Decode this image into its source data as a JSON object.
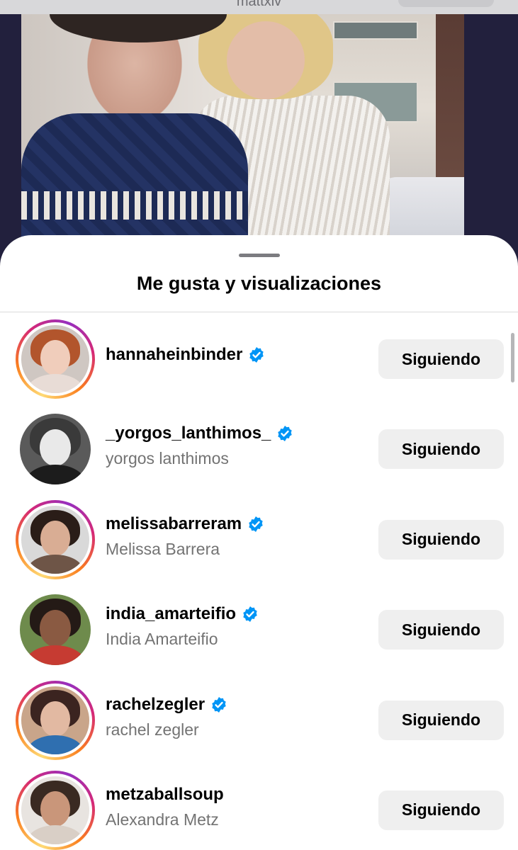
{
  "background": {
    "owner_username": "mattxiv"
  },
  "sheet": {
    "title": "Me gusta y visualizaciones"
  },
  "users": [
    {
      "username": "hannaheinbinder",
      "fullname": "",
      "verified": true,
      "story_ring": true,
      "button": "Siguiendo"
    },
    {
      "username": "_yorgos_lanthimos_",
      "fullname": "yorgos lanthimos",
      "verified": true,
      "story_ring": false,
      "button": "Siguiendo"
    },
    {
      "username": "melissabarreram",
      "fullname": "Melissa Barrera",
      "verified": true,
      "story_ring": true,
      "button": "Siguiendo"
    },
    {
      "username": "india_amarteifio",
      "fullname": "India Amarteifio",
      "verified": true,
      "story_ring": false,
      "button": "Siguiendo"
    },
    {
      "username": "rachelzegler",
      "fullname": "rachel zegler",
      "verified": true,
      "story_ring": true,
      "button": "Siguiendo"
    },
    {
      "username": "metzaballsoup",
      "fullname": "Alexandra Metz",
      "verified": false,
      "story_ring": true,
      "button": "Siguiendo"
    }
  ],
  "colors": {
    "verified_badge": "#0095f6",
    "button_bg": "#efefef",
    "secondary_text": "#737373"
  }
}
